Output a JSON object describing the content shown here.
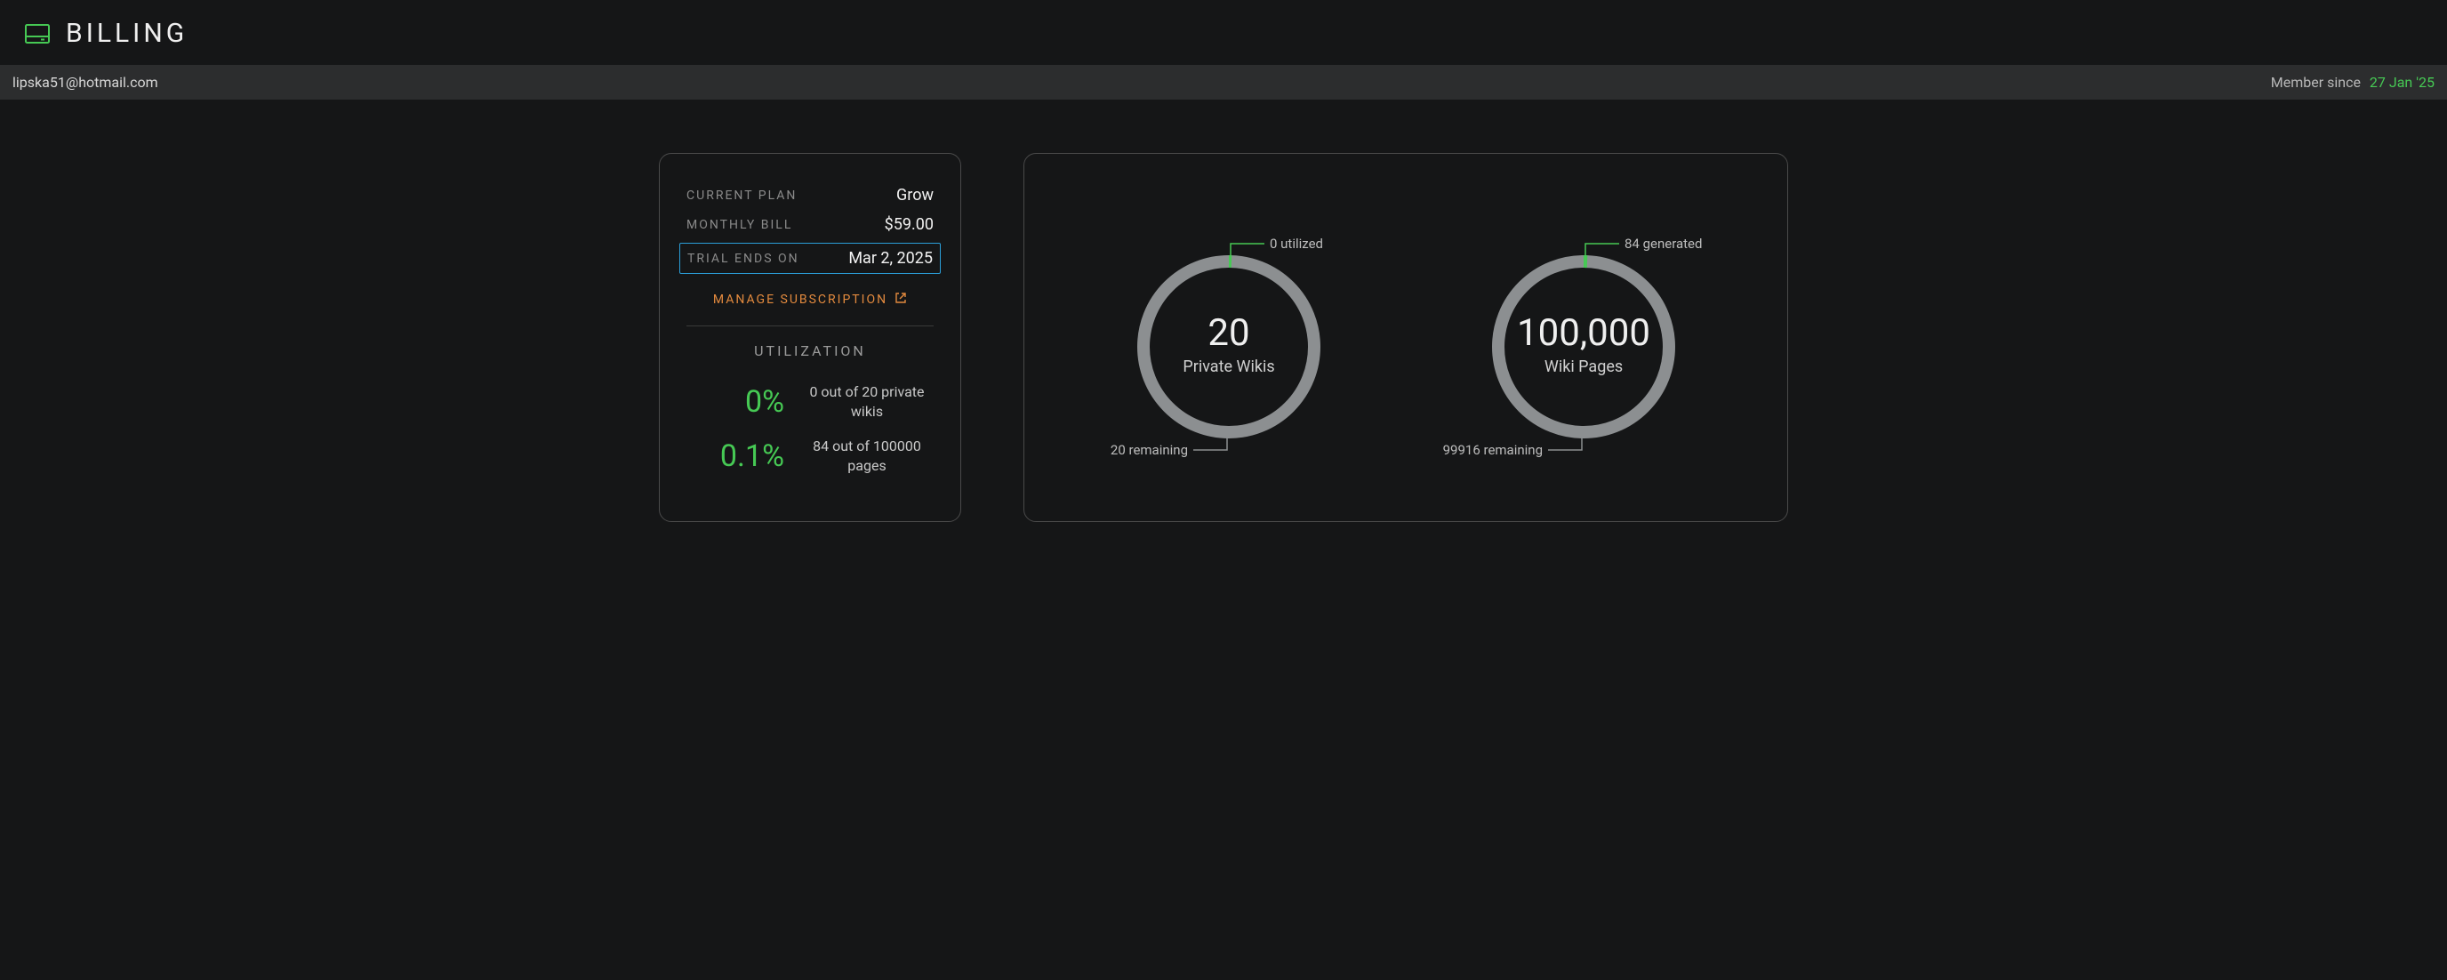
{
  "header": {
    "title": "BILLING"
  },
  "infobar": {
    "email": "lipska51@hotmail.com",
    "member_since_label": "Member since",
    "member_since_date": "27 Jan '25"
  },
  "plan": {
    "current_plan_label": "CURRENT PLAN",
    "current_plan_value": "Grow",
    "monthly_bill_label": "MONTHLY BILL",
    "monthly_bill_value": "$59.00",
    "trial_ends_label": "TRIAL ENDS ON",
    "trial_ends_value": "Mar 2, 2025",
    "manage_label": "MANAGE SUBSCRIPTION"
  },
  "utilization": {
    "heading": "UTILIZATION",
    "rows": [
      {
        "pct": "0%",
        "desc": "0 out of 20 private wikis"
      },
      {
        "pct": "0.1%",
        "desc": "84 out of 100000 pages"
      }
    ]
  },
  "gauges": {
    "wikis": {
      "center_num": "20",
      "center_label": "Private Wikis",
      "top_callout": "0 utilized",
      "bottom_callout": "20 remaining"
    },
    "pages": {
      "center_num": "100,000",
      "center_label": "Wiki Pages",
      "top_callout": "84 generated",
      "bottom_callout": "99916 remaining"
    }
  },
  "chart_data": [
    {
      "type": "pie",
      "title": "Private Wikis",
      "total": 20,
      "series": [
        {
          "name": "utilized",
          "value": 0
        },
        {
          "name": "remaining",
          "value": 20
        }
      ]
    },
    {
      "type": "pie",
      "title": "Wiki Pages",
      "total": 100000,
      "series": [
        {
          "name": "generated",
          "value": 84
        },
        {
          "name": "remaining",
          "value": 99916
        }
      ]
    }
  ]
}
